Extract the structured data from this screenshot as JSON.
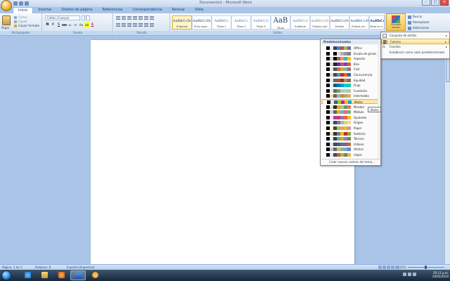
{
  "window": {
    "title": " Documento1 - Microsoft Word",
    "ctrl_min": "–",
    "ctrl_max": "□",
    "ctrl_close": "✕"
  },
  "tabs": [
    "Inicio",
    "Insertar",
    "Diseño de página",
    "Referencias",
    "Correspondencia",
    "Revisar",
    "Vista"
  ],
  "ribbon": {
    "clipboard": {
      "paste": "Pegar",
      "cut": "Cortar",
      "copy": "Copiar",
      "format_painter": "Copiar formato",
      "label": "Portapapeles"
    },
    "font": {
      "name": "Calibri (Cuerpo)",
      "size": "11",
      "label": "Fuente",
      "bold": "N",
      "italic": "K",
      "underline": "S",
      "strike": "abc",
      "sub": "x₂",
      "sup": "x²",
      "case": "Aa",
      "highlight": "ab",
      "color": "A"
    },
    "paragraph": {
      "label": "Párrafo"
    },
    "styles": {
      "label": "Estilos",
      "tiles": [
        {
          "sample": "AaBbCcDc",
          "name": "¶ Normal"
        },
        {
          "sample": "AaBbCcDc",
          "name": "¶ Sin espa..."
        },
        {
          "sample": "AaBbCc",
          "name": "Título 1"
        },
        {
          "sample": "AaBbCc",
          "name": "Título 2"
        },
        {
          "sample": "AaBbCcI",
          "name": "Título 3"
        },
        {
          "sample": "AaB",
          "name": "Título"
        },
        {
          "sample": "AaBbCcI",
          "name": "Subtítulo"
        },
        {
          "sample": "AaBbCcDc",
          "name": "Énfasis sutil"
        },
        {
          "sample": "AaBbCcDc",
          "name": "Énfasis"
        },
        {
          "sample": "AaBbCcDc",
          "name": "Énfasis int..."
        },
        {
          "sample": "AaBbCcDc",
          "name": "Texto en n..."
        }
      ]
    },
    "change_styles": "Cambiar estilos",
    "editing": {
      "find": "Buscar",
      "replace": "Reemplazar",
      "select": "Seleccionar"
    }
  },
  "change_styles_menu": {
    "items": [
      {
        "label": "Conjunto de estilos",
        "icon": "style-set-icon"
      },
      {
        "label": "Colores",
        "icon": "colors-icon"
      },
      {
        "label": "Fuentes",
        "icon": "fonts-icon"
      },
      {
        "label": "Establecer como valor predeterminado",
        "icon": ""
      }
    ],
    "arrow": "▸"
  },
  "colors_menu": {
    "header": "Predeterminados",
    "footer": "Crear nuevos colores del tema...",
    "hovered": "Metro",
    "themes": [
      {
        "name": "Office",
        "sw": [
          "#ffffff",
          "#000000",
          "#eeece1",
          "#1f497d",
          "#4f81bd",
          "#c0504d",
          "#9bbb59",
          "#8064a2"
        ]
      },
      {
        "name": "Escala de grises",
        "sw": [
          "#ffffff",
          "#000000",
          "#f8f8f8",
          "#000000",
          "#dddddd",
          "#b2b2b2",
          "#969696",
          "#808080"
        ]
      },
      {
        "name": "Aspecto",
        "sw": [
          "#ffffff",
          "#000000",
          "#d5d5d5",
          "#000000",
          "#c0504d",
          "#f79646",
          "#4bacc6",
          "#ffc000"
        ]
      },
      {
        "name": "Brio",
        "sw": [
          "#ffffff",
          "#000000",
          "#d9d9d9",
          "#1f1b4d",
          "#4e3a9f",
          "#c94b96",
          "#8d3fa0",
          "#e25a32"
        ]
      },
      {
        "name": "Civil",
        "sw": [
          "#ffffff",
          "#000000",
          "#e6e6e6",
          "#555555",
          "#d16349",
          "#ccb400",
          "#8cadae",
          "#8c7b70"
        ]
      },
      {
        "name": "Concurrencia",
        "sw": [
          "#ffffff",
          "#000000",
          "#dedede",
          "#464646",
          "#2da2bf",
          "#da1f28",
          "#eb641b",
          "#39639d"
        ]
      },
      {
        "name": "Equidad",
        "sw": [
          "#ffffff",
          "#000000",
          "#e9e5dc",
          "#696464",
          "#d34817",
          "#9b2d1f",
          "#a28e6a",
          "#956251"
        ]
      },
      {
        "name": "Flujo",
        "sw": [
          "#ffffff",
          "#000000",
          "#dbf5f9",
          "#04617b",
          "#0f6fc6",
          "#009dd9",
          "#0bd0d9",
          "#10cf9b"
        ]
      },
      {
        "name": "Fundición",
        "sw": [
          "#ffffff",
          "#000000",
          "#eaebde",
          "#676a55",
          "#72a376",
          "#b0ccb0",
          "#a8cdd7",
          "#c0beaf"
        ]
      },
      {
        "name": "Intermedio",
        "sw": [
          "#ffffff",
          "#000000",
          "#ebddc3",
          "#775f55",
          "#94b6d2",
          "#dd8047",
          "#a5ab81",
          "#d8b25c"
        ]
      },
      {
        "name": "Metro",
        "sw": [
          "#ffffff",
          "#000000",
          "#d6ecff",
          "#4e5b6f",
          "#7fd13b",
          "#ea157a",
          "#feb80a",
          "#00addc"
        ]
      },
      {
        "name": "Mirador",
        "sw": [
          "#ffffff",
          "#000000",
          "#e3ded1",
          "#1d331f",
          "#ff9900",
          "#a8c68e",
          "#739271",
          "#ea7b5c"
        ]
      },
      {
        "name": "Módulo",
        "sw": [
          "#ffffff",
          "#000000",
          "#d4d4d4",
          "#5a6378",
          "#f0ad00",
          "#60b5cc",
          "#e66c7d",
          "#6bb76d"
        ]
      },
      {
        "name": "Opulento",
        "sw": [
          "#ffffff",
          "#000000",
          "#f4e7ed",
          "#b13f9a",
          "#b83d68",
          "#ac66bb",
          "#de6c36",
          "#f9b639"
        ]
      },
      {
        "name": "Origen",
        "sw": [
          "#ffffff",
          "#000000",
          "#dde9ec",
          "#464653",
          "#727ca3",
          "#9fb8cd",
          "#d2da7a",
          "#fada7a"
        ]
      },
      {
        "name": "Papel",
        "sw": [
          "#ffffff",
          "#000000",
          "#fefac9",
          "#444d26",
          "#a5b592",
          "#f3a447",
          "#e7bc29",
          "#d092a7"
        ]
      },
      {
        "name": "Solsticio",
        "sw": [
          "#ffffff",
          "#000000",
          "#e7dec9",
          "#4f271c",
          "#3891a7",
          "#feb80a",
          "#c32d2e",
          "#84aa33"
        ]
      },
      {
        "name": "Técnico",
        "sw": [
          "#ffffff",
          "#000000",
          "#dbefff",
          "#3b3b3b",
          "#6ea0b0",
          "#ccaf0a",
          "#8d89a4",
          "#748560"
        ]
      },
      {
        "name": "Urbano",
        "sw": [
          "#ffffff",
          "#000000",
          "#dedede",
          "#424456",
          "#53548a",
          "#438086",
          "#a04da3",
          "#c4652d"
        ]
      },
      {
        "name": "Vértice",
        "sw": [
          "#ffffff",
          "#000000",
          "#c9c2d1",
          "#69676d",
          "#ceb966",
          "#9cb084",
          "#6bb1c9",
          "#6585cf"
        ]
      },
      {
        "name": "Viajes",
        "sw": [
          "#ffffff",
          "#000000",
          "#dfe3e5",
          "#3d4a5a",
          "#cf543f",
          "#b5ae53",
          "#848058",
          "#e8b54d"
        ]
      }
    ]
  },
  "tooltip": "Metro",
  "status": {
    "page": "Página: 1 de 1",
    "words": "Palabras: 0",
    "language": "Español (Argentina)",
    "zoom": "125%"
  },
  "taskbar": {
    "time": "05:11 p.m.",
    "date": "20/03/2010"
  }
}
